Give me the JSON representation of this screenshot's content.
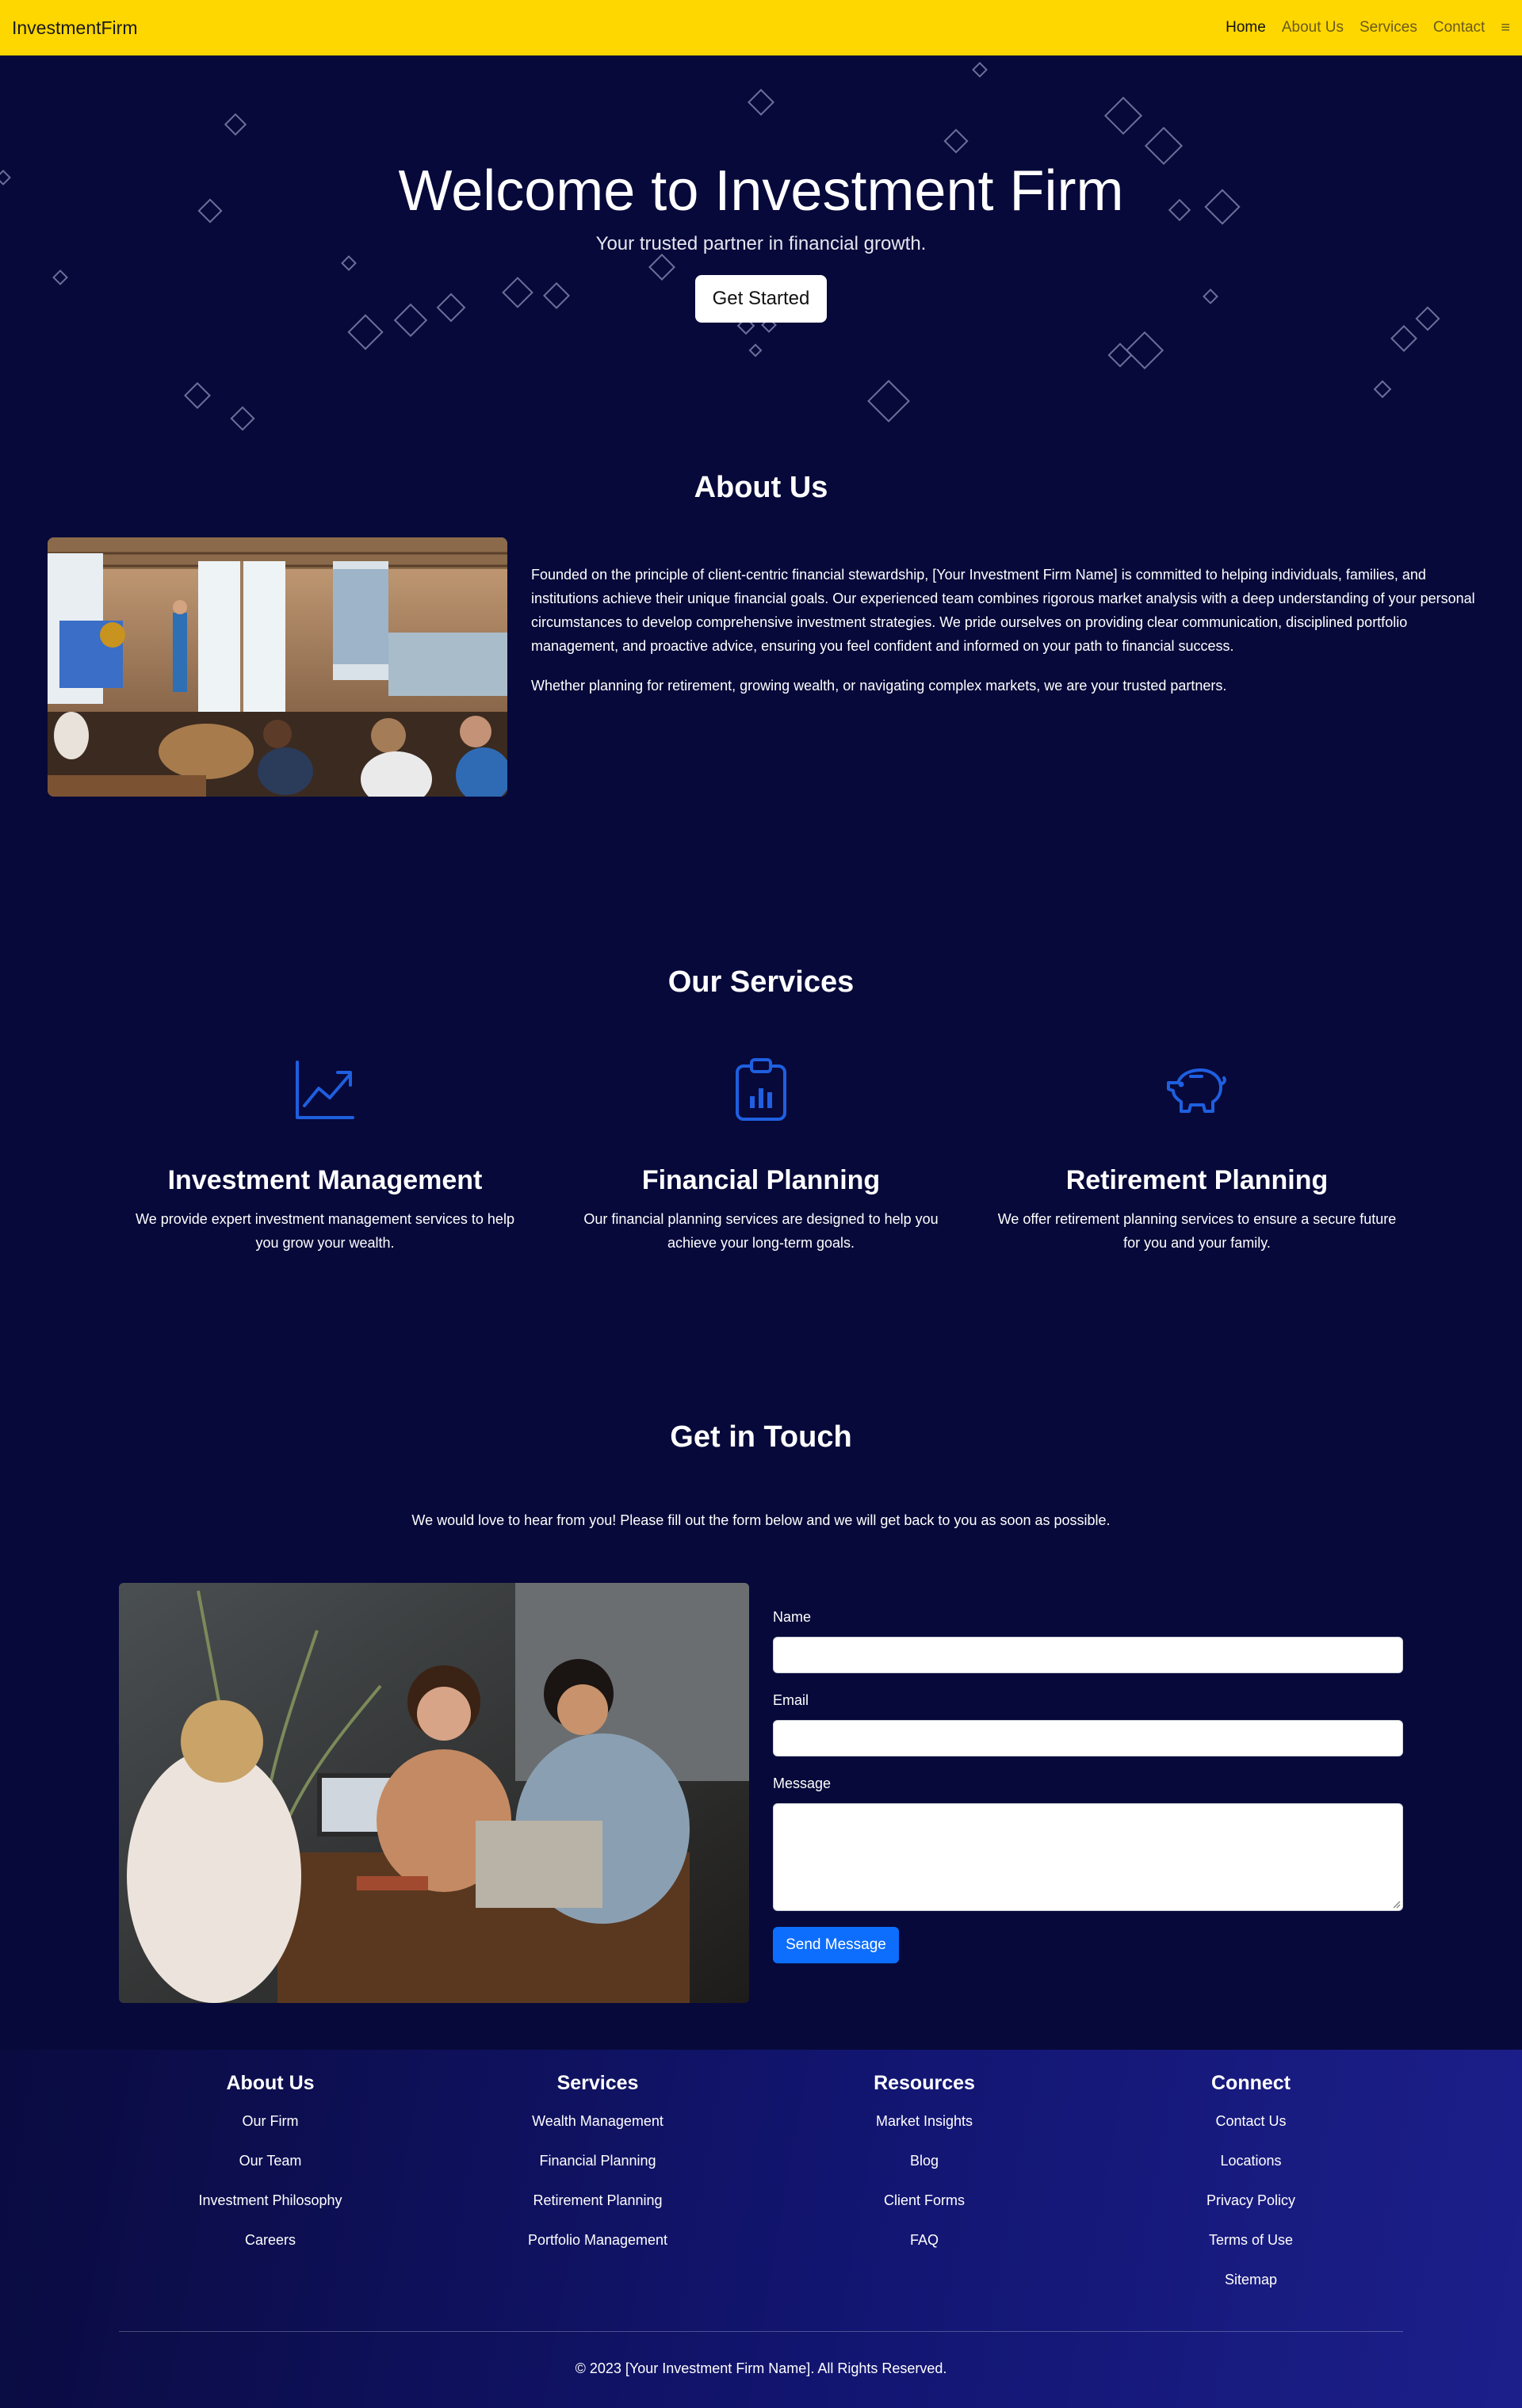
{
  "navbar": {
    "brand": "InvestmentFirm",
    "links": [
      "Home",
      "About Us",
      "Services",
      "Contact"
    ],
    "menu_icon": "hamburger-icon"
  },
  "hero": {
    "title": "Welcome to Investment Firm",
    "subtitle": "Your trusted partner in financial growth.",
    "button": "Get Started"
  },
  "about": {
    "title": "About Us",
    "paragraph1": "Founded on the principle of client-centric financial stewardship, [Your Investment Firm Name] is committed to helping individuals, families, and institutions achieve their unique financial goals. Our experienced team combines rigorous market analysis with a deep understanding of your personal circumstances to develop comprehensive investment strategies. We pride ourselves on providing clear communication, disciplined portfolio management, and proactive advice, ensuring you feel confident and informed on your path to financial success.",
    "paragraph2": "Whether planning for retirement, growing wealth, or navigating complex markets, we are your trusted partners."
  },
  "services": {
    "title": "Our Services",
    "items": [
      {
        "icon": "chart-line-icon",
        "title": "Investment Management",
        "text": "We provide expert investment management services to help you grow your wealth."
      },
      {
        "icon": "clipboard-data-icon",
        "title": "Financial Planning",
        "text": "Our financial planning services are designed to help you achieve your long-term goals."
      },
      {
        "icon": "piggy-bank-icon",
        "title": "Retirement Planning",
        "text": "We offer retirement planning services to ensure a secure future for you and your family."
      }
    ]
  },
  "contact": {
    "title": "Get in Touch",
    "intro": "We would love to hear from you! Please fill out the form below and we will get back to you as soon as possible.",
    "name_label": "Name",
    "email_label": "Email",
    "message_label": "Message",
    "button": "Send Message"
  },
  "footer": {
    "columns": [
      {
        "title": "About Us",
        "links": [
          "Our Firm",
          "Our Team",
          "Investment Philosophy",
          "Careers"
        ]
      },
      {
        "title": "Services",
        "links": [
          "Wealth Management",
          "Financial Planning",
          "Retirement Planning",
          "Portfolio Management"
        ]
      },
      {
        "title": "Resources",
        "links": [
          "Market Insights",
          "Blog",
          "Client Forms",
          "FAQ"
        ]
      },
      {
        "title": "Connect",
        "links": [
          "Contact Us",
          "Locations",
          "Privacy Policy",
          "Terms of Use",
          "Sitemap"
        ]
      }
    ],
    "copyright": "© 2023 [Your Investment Firm Name]. All Rights Reserved."
  },
  "colors": {
    "navbar_bg": "#ffd700",
    "page_bg": "#07093a",
    "accent_blue": "#1f5fe0",
    "button_blue": "#0d6efd"
  }
}
